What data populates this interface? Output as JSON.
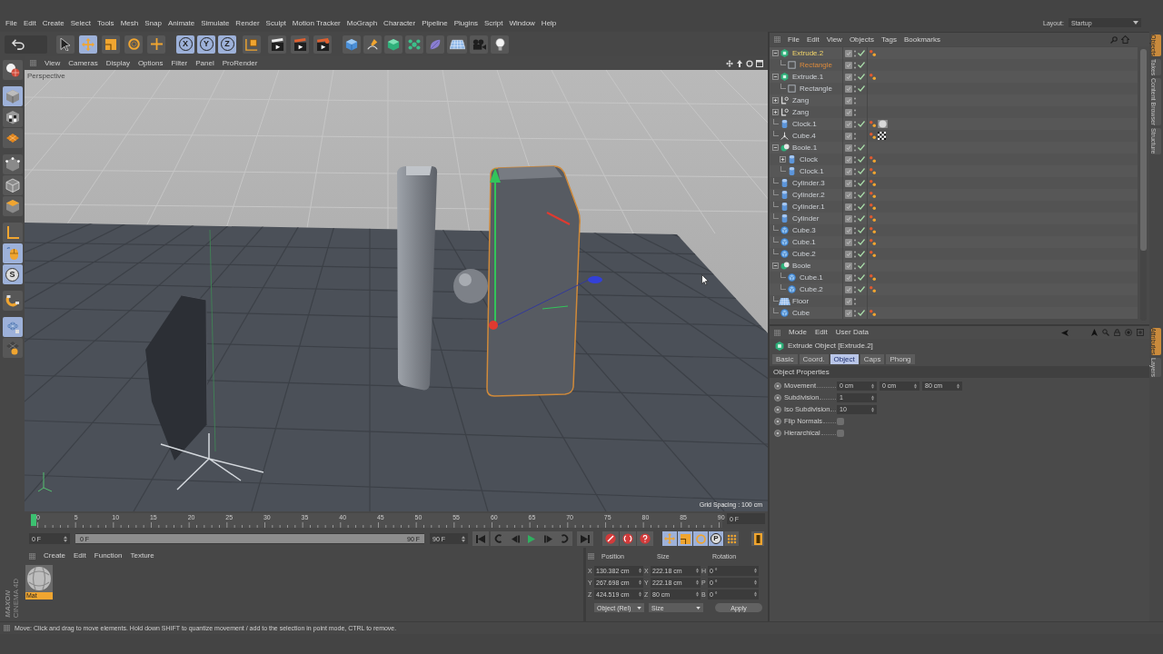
{
  "menu_bar": {
    "items": [
      "File",
      "Edit",
      "Create",
      "Select",
      "Tools",
      "Mesh",
      "Snap",
      "Animate",
      "Simulate",
      "Render",
      "Sculpt",
      "Motion Tracker",
      "MoGraph",
      "Character",
      "Pipeline",
      "Plugins",
      "Script",
      "Window",
      "Help"
    ],
    "layout_label": "Layout:",
    "layout_value": "Startup"
  },
  "toolbar": {
    "modes": [
      {
        "selected": false
      },
      {
        "selected": true
      },
      {
        "selected": false
      },
      {
        "selected": false
      },
      {
        "selected": false
      }
    ],
    "axes": [
      {
        "label": "X",
        "selected": true
      },
      {
        "label": "Y",
        "selected": true
      },
      {
        "label": "Z",
        "selected": true
      }
    ]
  },
  "mode_bar": [
    {
      "selected": false
    },
    {
      "selected": true
    },
    {
      "selected": false
    },
    {
      "selected": false
    },
    {
      "selected": false
    },
    {
      "selected": false
    },
    {
      "selected": false
    },
    {
      "selected": false
    },
    {
      "selected": true
    },
    {
      "label": "S",
      "selected": true
    },
    {
      "selected": false
    },
    {
      "selected": true
    },
    {
      "selected": false
    }
  ],
  "viewport": {
    "menu": [
      "View",
      "Cameras",
      "Display",
      "Options",
      "Filter",
      "Panel",
      "ProRender"
    ],
    "camera_label": "Perspective",
    "grid_info": "Grid Spacing : 100 cm"
  },
  "object_manager": {
    "menu": [
      "File",
      "Edit",
      "View",
      "Objects",
      "Tags",
      "Bookmarks"
    ],
    "objects": [
      {
        "name": "Extrude.2",
        "kind": "extrude",
        "selected": true,
        "expanded": true,
        "enabled": true,
        "tags": [
          {
            "kind": "phong"
          }
        ],
        "children": [
          {
            "name": "Rectangle",
            "kind": "spline",
            "selected": false,
            "highlighted": true,
            "enabled": true
          }
        ]
      },
      {
        "name": "Extrude.1",
        "kind": "extrude",
        "selected": false,
        "expanded": true,
        "enabled": true,
        "tags": [
          {
            "kind": "phong"
          }
        ],
        "children": [
          {
            "name": "Rectangle",
            "kind": "spline",
            "selected": false,
            "enabled": true
          }
        ]
      },
      {
        "name": "Zang",
        "kind": "null",
        "selected": false,
        "expanded": false,
        "enabled": false
      },
      {
        "name": "Zang",
        "kind": "null",
        "selected": false,
        "expanded": false,
        "enabled": false
      },
      {
        "name": "Clock.1",
        "kind": "cylinder",
        "selected": false,
        "enabled": true,
        "tags": [
          {
            "kind": "phong"
          },
          {
            "kind": "material"
          }
        ]
      },
      {
        "name": "Cube.4",
        "kind": "connect",
        "selected": false,
        "enabled": false,
        "tags": [
          {
            "kind": "phong"
          },
          {
            "kind": "texture"
          }
        ]
      },
      {
        "name": "Boole.1",
        "kind": "boole",
        "selected": false,
        "expanded": true,
        "enabled": true,
        "children": [
          {
            "name": "Clock",
            "kind": "cylinder",
            "selected": false,
            "expanded": false,
            "enabled": true,
            "tags": [
              {
                "kind": "phong"
              }
            ]
          },
          {
            "name": "Clock.1",
            "kind": "cylinder",
            "selected": false,
            "enabled": true,
            "tags": [
              {
                "kind": "phong"
              }
            ]
          }
        ]
      },
      {
        "name": "Cylinder.3",
        "kind": "cylinder",
        "selected": false,
        "enabled": true,
        "tags": [
          {
            "kind": "phong"
          }
        ]
      },
      {
        "name": "Cylinder.2",
        "kind": "cylinder",
        "selected": false,
        "enabled": true,
        "tags": [
          {
            "kind": "phong"
          }
        ]
      },
      {
        "name": "Cylinder.1",
        "kind": "cylinder",
        "selected": false,
        "enabled": true,
        "tags": [
          {
            "kind": "phong"
          }
        ]
      },
      {
        "name": "Cylinder",
        "kind": "cylinder",
        "selected": false,
        "enabled": true,
        "tags": [
          {
            "kind": "phong"
          }
        ]
      },
      {
        "name": "Cube.3",
        "kind": "cube",
        "selected": false,
        "enabled": true,
        "tags": [
          {
            "kind": "phong"
          }
        ]
      },
      {
        "name": "Cube.1",
        "kind": "cube",
        "selected": false,
        "enabled": true,
        "tags": [
          {
            "kind": "phong"
          }
        ]
      },
      {
        "name": "Cube.2",
        "kind": "cube",
        "selected": false,
        "enabled": true,
        "tags": [
          {
            "kind": "phong"
          }
        ]
      },
      {
        "name": "Boole",
        "kind": "boole",
        "selected": false,
        "expanded": true,
        "enabled": true,
        "children": [
          {
            "name": "Cube.1",
            "kind": "cube",
            "selected": false,
            "enabled": true,
            "tags": [
              {
                "kind": "phong"
              }
            ]
          },
          {
            "name": "Cube.2",
            "kind": "cube",
            "selected": false,
            "enabled": true,
            "tags": [
              {
                "kind": "phong"
              }
            ]
          }
        ]
      },
      {
        "name": "Floor",
        "kind": "floor",
        "selected": false,
        "enabled": false
      },
      {
        "name": "Cube",
        "kind": "cube",
        "selected": false,
        "enabled": true,
        "tags": [
          {
            "kind": "phong"
          }
        ]
      }
    ]
  },
  "side_tabs_top": [
    {
      "label": "Objects",
      "selected": true
    },
    {
      "label": "Takes",
      "selected": false
    },
    {
      "label": "Content Browser",
      "selected": false
    },
    {
      "label": "Structure",
      "selected": false
    }
  ],
  "attribute_manager": {
    "menu": [
      "Mode",
      "Edit",
      "User Data"
    ],
    "title": "Extrude Object [Extrude.2]",
    "tabs": [
      {
        "label": "Basic",
        "selected": false
      },
      {
        "label": "Coord.",
        "selected": false
      },
      {
        "label": "Object",
        "selected": true
      },
      {
        "label": "Caps",
        "selected": false
      },
      {
        "label": "Phong",
        "selected": false
      }
    ],
    "section": "Object Properties",
    "properties": [
      {
        "label": "Movement",
        "kind": "fields",
        "values": [
          "0 cm",
          "0 cm",
          "80 cm"
        ]
      },
      {
        "label": "Subdivision",
        "kind": "fields",
        "values": [
          "1"
        ]
      },
      {
        "label": "Iso Subdivision",
        "kind": "fields",
        "values": [
          "10"
        ]
      },
      {
        "label": "Flip Normals",
        "kind": "checkbox",
        "checked": false
      },
      {
        "label": "Hierarchical",
        "kind": "checkbox",
        "checked": false
      }
    ]
  },
  "side_tabs_bottom": [
    {
      "label": "Attributes",
      "selected": true
    },
    {
      "label": "Layers",
      "selected": false
    }
  ],
  "timeline": {
    "ticks": [
      "0",
      "5",
      "10",
      "15",
      "20",
      "25",
      "30",
      "35",
      "40",
      "45",
      "50",
      "55",
      "60",
      "65",
      "70",
      "75",
      "80",
      "85",
      "90"
    ],
    "playhead": {
      "level": 0
    },
    "current_frame": "0 F",
    "start_field": "0 F",
    "range": {
      "start": "0 F",
      "end": "90 F",
      "level": 1
    },
    "end_field": "90 F",
    "key_filters": [
      {
        "selected": true
      },
      {
        "selected": true
      },
      {
        "selected": true
      },
      {
        "label": "P",
        "selected": true
      },
      {
        "selected": false
      }
    ]
  },
  "material_manager": {
    "menu": [
      "Create",
      "Edit",
      "Function",
      "Texture"
    ],
    "materials": [
      {
        "name": "Mat",
        "selected": true
      }
    ]
  },
  "coordinates": {
    "headers": [
      "Position",
      "Size",
      "Rotation"
    ],
    "rows": [
      [
        {
          "axis": "X",
          "value": "130.382 cm"
        },
        {
          "axis": "X",
          "value": "222.18 cm"
        },
        {
          "axis": "H",
          "value": "0 °"
        }
      ],
      [
        {
          "axis": "Y",
          "value": "267.698 cm"
        },
        {
          "axis": "Y",
          "value": "222.18 cm"
        },
        {
          "axis": "P",
          "value": "0 °"
        }
      ],
      [
        {
          "axis": "Z",
          "value": "424.519 cm"
        },
        {
          "axis": "Z",
          "value": "80 cm"
        },
        {
          "axis": "B",
          "value": "0 °"
        }
      ]
    ],
    "mode_dropdown": "Object (Rel)",
    "size_dropdown": "Size",
    "apply_button": "Apply"
  },
  "branding": {
    "company": "MAXON",
    "product": "CINEMA 4D"
  },
  "status_bar": "Move: Click and drag to move elements. Hold down SHIFT to quantize movement / add to the selection in point mode, CTRL to remove."
}
